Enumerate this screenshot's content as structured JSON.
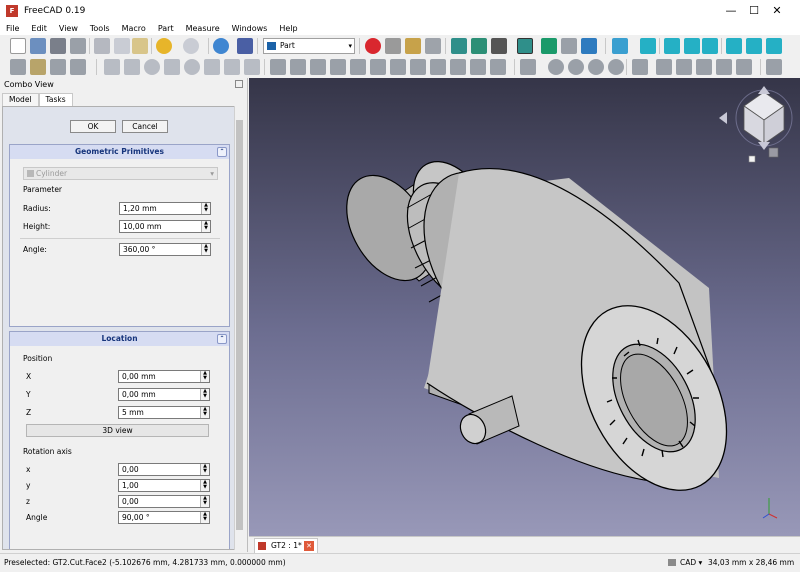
{
  "window": {
    "title": "FreeCAD 0.19",
    "min": "—",
    "max": "☐",
    "close": "✕"
  },
  "menu": [
    "File",
    "Edit",
    "View",
    "Tools",
    "Macro",
    "Part",
    "Measure",
    "Windows",
    "Help"
  ],
  "workbench": "Part",
  "combo": {
    "title": "Combo View",
    "tabs": [
      "Model",
      "Tasks"
    ],
    "ok": "OK",
    "cancel": "Cancel",
    "geo": {
      "title": "Geometric Primitives",
      "type": "Cylinder",
      "param_label": "Parameter",
      "radius_label": "Radius:",
      "radius": "1,20 mm",
      "height_label": "Height:",
      "height": "10,00 mm",
      "angle_label": "Angle:",
      "angle": "360,00 °"
    },
    "loc": {
      "title": "Location",
      "position_label": "Position",
      "x_label": "X",
      "x": "0,00 mm",
      "y_label": "Y",
      "y": "0,00 mm",
      "z_label": "Z",
      "z": "5 mm",
      "view_button": "3D view",
      "rot_label": "Rotation axis",
      "rx_label": "x",
      "rx": "0,00",
      "ry_label": "y",
      "ry": "1,00",
      "rz_label": "z",
      "rz": "0,00",
      "rangle_label": "Angle",
      "rangle": "90,00 °"
    }
  },
  "doc_tab": "GT2 : 1*",
  "status": {
    "text": "Preselected: GT2.Cut.Face2 (-5.102676 mm, 4.281733 mm, 0.000000 mm)",
    "nav": "CAD",
    "dims": "34,03 mm x 28,46 mm"
  },
  "navcube": {
    "faces": [
      "TOP",
      "FRONT",
      "RIGHT"
    ]
  },
  "colors": {
    "record": "#d9272e",
    "accent": "#17357c",
    "model": "#c8c8c8"
  }
}
